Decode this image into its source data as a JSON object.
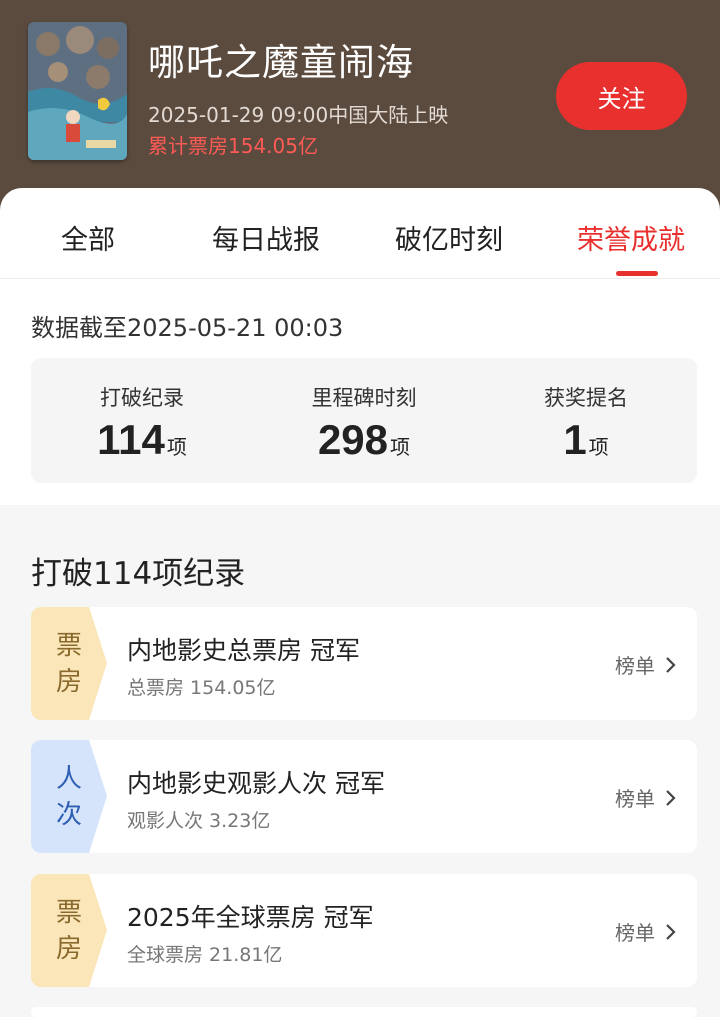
{
  "movie": {
    "title": "哪吒之魔童闹海",
    "release": "2025-01-29 09:00中国大陆上映",
    "box_office": "累计票房154.05亿",
    "follow_label": "关注"
  },
  "tabs": [
    {
      "label": "全部"
    },
    {
      "label": "每日战报"
    },
    {
      "label": "破亿时刻"
    },
    {
      "label": "荣誉成就"
    }
  ],
  "active_tab": "荣誉成就",
  "as_of": "数据截至2025-05-21  00:03",
  "stats": [
    {
      "label": "打破纪录",
      "value": "114",
      "unit": "项"
    },
    {
      "label": "里程碑时刻",
      "value": "298",
      "unit": "项"
    },
    {
      "label": "获奖提名",
      "value": "1",
      "unit": "项"
    }
  ],
  "records_section": {
    "title": "打破114项纪录",
    "items": [
      {
        "tag_top": "票",
        "tag_bottom": "房",
        "tag_color": "#fbe6b9",
        "title": "内地影史总票房 冠军",
        "subtitle": "总票房 154.05亿",
        "link": "榜单"
      },
      {
        "tag_top": "人",
        "tag_bottom": "次",
        "tag_color": "#d6e4fb",
        "title": "内地影史观影人次 冠军",
        "subtitle": "观影人次 3.23亿",
        "link": "榜单"
      },
      {
        "tag_top": "票",
        "tag_bottom": "房",
        "tag_color": "#fbe6b9",
        "title": "2025年全球票房 冠军",
        "subtitle": "全球票房 21.81亿",
        "link": "榜单"
      }
    ]
  },
  "colors": {
    "header_bg": "#5b4b3f",
    "accent_red": "#e8312f",
    "gold_tag": "#fbe6b9",
    "blue_tag": "#d6e4fb"
  },
  "icons": [
    "chevron-right-icon"
  ]
}
